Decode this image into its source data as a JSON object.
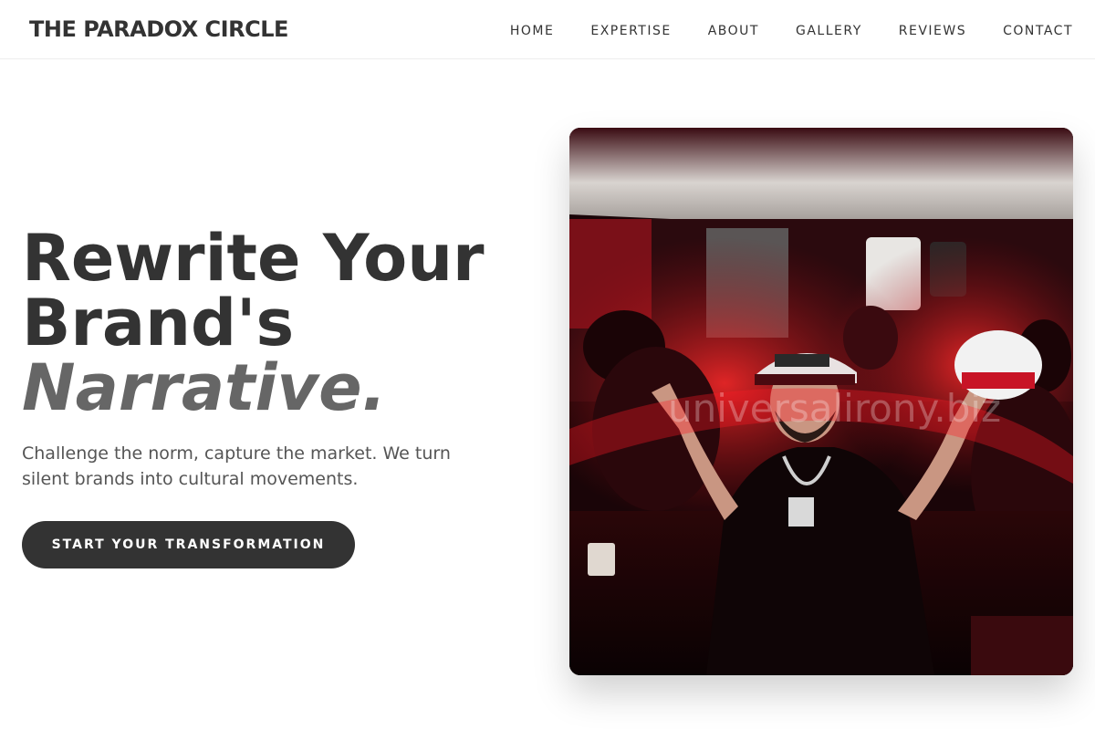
{
  "brand": {
    "name": "THE PARADOX CIRCLE"
  },
  "nav": {
    "items": [
      {
        "label": "HOME"
      },
      {
        "label": "EXPERTISE"
      },
      {
        "label": "ABOUT"
      },
      {
        "label": "GALLERY"
      },
      {
        "label": "REVIEWS"
      },
      {
        "label": "CONTACT"
      }
    ]
  },
  "hero": {
    "headline_line1": "Rewrite Your",
    "headline_line2": "Brand's",
    "headline_accent": "Narrative.",
    "subtext": "Challenge the norm, capture the market. We turn silent brands into cultural movements.",
    "cta_label": "START YOUR TRANSFORMATION",
    "image_watermark": "universalirony.biz"
  },
  "colors": {
    "text_primary": "#333333",
    "text_accent": "#666666",
    "button_bg": "#333333",
    "button_text": "#ffffff"
  }
}
